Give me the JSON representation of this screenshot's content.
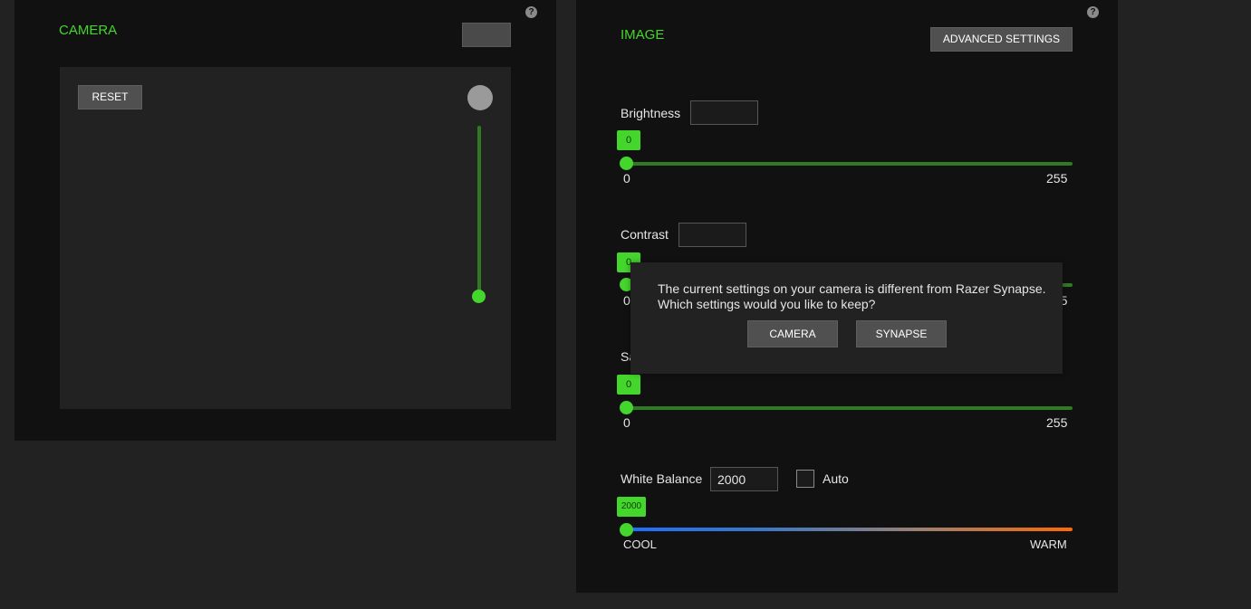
{
  "camera": {
    "title": "CAMERA",
    "help": "?",
    "reset_label": "RESET"
  },
  "image": {
    "title": "IMAGE",
    "help": "?",
    "advanced_label": "ADVANCED SETTINGS",
    "brightness": {
      "label": "Brightness",
      "value": "0",
      "min": "0",
      "max": "255"
    },
    "contrast": {
      "label": "Contrast",
      "value": "0",
      "min": "0",
      "max": "255"
    },
    "saturation": {
      "label": "Saturation",
      "value": "0",
      "min": "0",
      "max": "255"
    },
    "white_balance": {
      "label": "White Balance",
      "value": "2000",
      "auto_label": "Auto",
      "auto_checked": false,
      "min_label": "COOL",
      "max_label": "WARM"
    }
  },
  "dialog": {
    "message_line1": "The current settings on your camera is different from Razer Synapse.",
    "message_line2": "Which settings would you like to keep?",
    "camera_label": "CAMERA",
    "synapse_label": "SYNAPSE"
  },
  "colors": {
    "accent": "#44d62c",
    "track": "#2f7a22",
    "cool": "#1e6fff",
    "warm": "#ff6a00"
  }
}
